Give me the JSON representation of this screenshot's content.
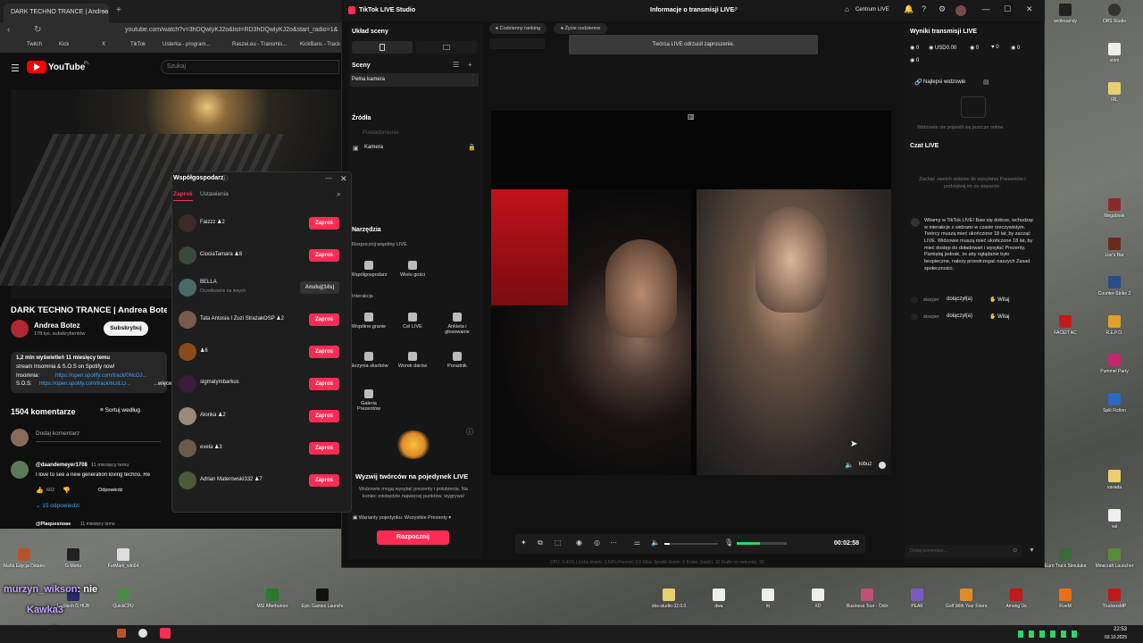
{
  "browser": {
    "tab_title": "DARK TECHNO TRANCE | Andrea",
    "url": "youtube.com/watch?v=3hDQwlyKJ2o&list=RD3hDQwlyKJ2o&start_radio=1&",
    "bookmarks": [
      "Twitch",
      "Kick",
      "X",
      "TikTok",
      "Usterka - program...",
      "Raszei.eu - Transmis...",
      "KickBans - Track"
    ],
    "youtube": {
      "logo_text": "YouTube",
      "country": "PL",
      "search_placeholder": "Szukaj",
      "video_title": "DARK TECHNO TRANCE | Andrea Botez",
      "channel": "Andrea Botez",
      "subscribers": "178 tys. subskrybentów",
      "subscribe": "Subskrybuj",
      "stats": "1,2 mln wyświetleń  11 miesięcy temu",
      "desc1": "stream Insomnia & S.O.S on Spotify now!",
      "desc2_label": "Insomnia:",
      "desc2_link": "https://open.spotify.com/track/0NcOJ...",
      "desc3_label": "S.O.S:",
      "desc3_link": "https://open.spotify.com/track/6GILO...",
      "more": "...więcej",
      "comments_count": "1504 komentarze",
      "sort": "Sortuj według",
      "add_comment": "Dodaj komentarz",
      "comment_author": "@daandemeyer1708",
      "comment_time": "11 miesięcy temu",
      "comment_text": "I love to see a new generation loving techno. Re",
      "comment_likes": "602",
      "reply": "Odpowiedz",
      "replies": "15 odpowiedzi",
      "next_author": "@Plaquesnoae",
      "next_time": "11 miesięcy temu"
    }
  },
  "cohost": {
    "title": "Współgospodarz",
    "tab_invite": "Zaproś",
    "tab_settings": "Ustawienia",
    "invite_label": "Zaproś",
    "cancel_label": "Anuluj(14s)",
    "rows": [
      {
        "name": "Faizzz",
        "count": "2",
        "status": "invite"
      },
      {
        "name": "CiociaTamara",
        "count": "8",
        "status": "invite"
      },
      {
        "name": "BELLA",
        "sub": "Oczekiwanie na innych",
        "status": "cancel"
      },
      {
        "name": "Tata Antosia I Zuzi StrażakOSP",
        "count": "2",
        "status": "invite"
      },
      {
        "name": "",
        "count": "6",
        "status": "invite"
      },
      {
        "name": "sigmatymbarkus",
        "count": "",
        "status": "invite"
      },
      {
        "name": "Alonka",
        "count": "2",
        "status": "invite"
      },
      {
        "name": "evela",
        "count": "3",
        "status": "invite"
      },
      {
        "name": "Adrian Materowski332",
        "count": "7",
        "status": "invite"
      }
    ]
  },
  "tiktok": {
    "app_title": "TikTok LIVE Studio",
    "window_title": "Informacje o transmisji LIVE",
    "live_center": "Centrum LIVE",
    "scene_layout": "Układ sceny",
    "scenes": "Sceny",
    "scene_item": "Pełna kamera",
    "sources": "Źródła",
    "source_disabled": "Powiadomienie",
    "source_camera": "Kamera",
    "tools": "Narzędzia",
    "joint_live": "Rozpocznij wspólny LIVE",
    "interaction": "Interakcja",
    "tool_items": [
      {
        "label": "Współgospodarz"
      },
      {
        "label": "Wielu gości"
      },
      {
        "label": "Wspólne granie"
      },
      {
        "label": "Cel LIVE"
      },
      {
        "label": "Ankieta i głosowanie"
      },
      {
        "label": "Skrzynia skarbów"
      },
      {
        "label": "Worek darów"
      },
      {
        "label": "Poradnik"
      },
      {
        "label": "Galeria Prezentów"
      }
    ],
    "battle_title": "Wyzwij twórców na pojedynek LIVE",
    "battle_desc": "Widzowie mogą wysyłać prezenty i polubienia. Na koniec zdobędzie najwięcej punktów, wygrywa!",
    "battle_variant": "Warianty pojedynku: Wszystkie Prezenty",
    "start_button": "Rozpocznij",
    "tags": [
      "Codzienny ranking",
      "Życie codzienne"
    ],
    "notice": "Twórca LIVE odrzucił zaproszenie.",
    "partner_name": "łobuz",
    "timer": "00:02:58",
    "stats_line": "CPU: 3.41%   Liczba klatek: 1.54%   Przesył: 3.6 Mb/s   Spadki klatek: 0   Koder (klatki): 30   Klatki na sekundę: 30",
    "results_title": "Wyniki transmisji LIVE",
    "result_values": [
      "0",
      "USD0.00",
      "0",
      "0",
      "0",
      "0"
    ],
    "top_viewers": "Najlepsi widzowie",
    "top_viewers_empty": "Widzowie nie pojawili się jeszcze online",
    "chat_title": "Czat LIVE",
    "chat_empty": "Zachęć swoich widzów do wysyłania Prezentów i podzięknij im za wsparcie.",
    "welcome_msg": "Witamy w TikTok LIVE! Baw się dobrze, wchodząc w interakcje z widzami w czasie rzeczywistym. Twórcy muszą mieć ukończone 18 lat, by zacząć LIVE. Widzowie muszą mieć ukończone 18 lat, by mieć dostęp do doładowań i wysyłać Prezenty. Pamiętaj jednak, że aby oglądanie było bezpieczne, należy przestrzegać naszych Zasad społeczności.",
    "join_events": [
      {
        "user": "skacper",
        "text": "dołączył(a)",
        "action": "Witaj"
      },
      {
        "user": "skacper",
        "text": "dołączył(a)",
        "action": "Witaj"
      }
    ],
    "chat_placeholder": "Dodaj komentarz..."
  },
  "overlay": {
    "line1_user": "murzyn_wikson",
    "line1_text": ": nie",
    "line2_user": "Kawka3",
    "line3_user": "murzyn_wikson",
    "line3_text": ":"
  },
  "desktop": {
    "right_icons": [
      "wrótreamdy",
      "OBS Studio",
      "strim",
      "IRL",
      "Megabonk",
      "Liar's Bar",
      "Counter-Strike 2",
      "FACEIT AC",
      "R.E.P.O.",
      "Pummel Party",
      "Split Fiction",
      "vavada",
      "val",
      "Euro Truck Simulator 2",
      "Minecraft Launcher",
      "TruckersMP"
    ],
    "bottom_icons": [
      "Mafia Edycja Ostateczna",
      "G-Menu",
      "FurMark_win64",
      "Logitech G HUB",
      "QuickCPU",
      "MSI Afterburner",
      "Epic Games Launcher",
      "obs-studio-32.0.0",
      "dwa",
      "ttt",
      "XD",
      "Business Tour - Online Multiplay...",
      "PEAK",
      "Golf With Your Friends",
      "Among Us",
      "FiveM"
    ],
    "top_left_icons": [
      "Mafia Edycja Ostateczna",
      "G-Menu",
      "FurMark_win64"
    ],
    "clock": "22:53",
    "date": "03.10.2025"
  },
  "colors": {
    "accent": "#fe2c55",
    "youtube_red": "#ff0000",
    "studio_bg": "#121212"
  }
}
